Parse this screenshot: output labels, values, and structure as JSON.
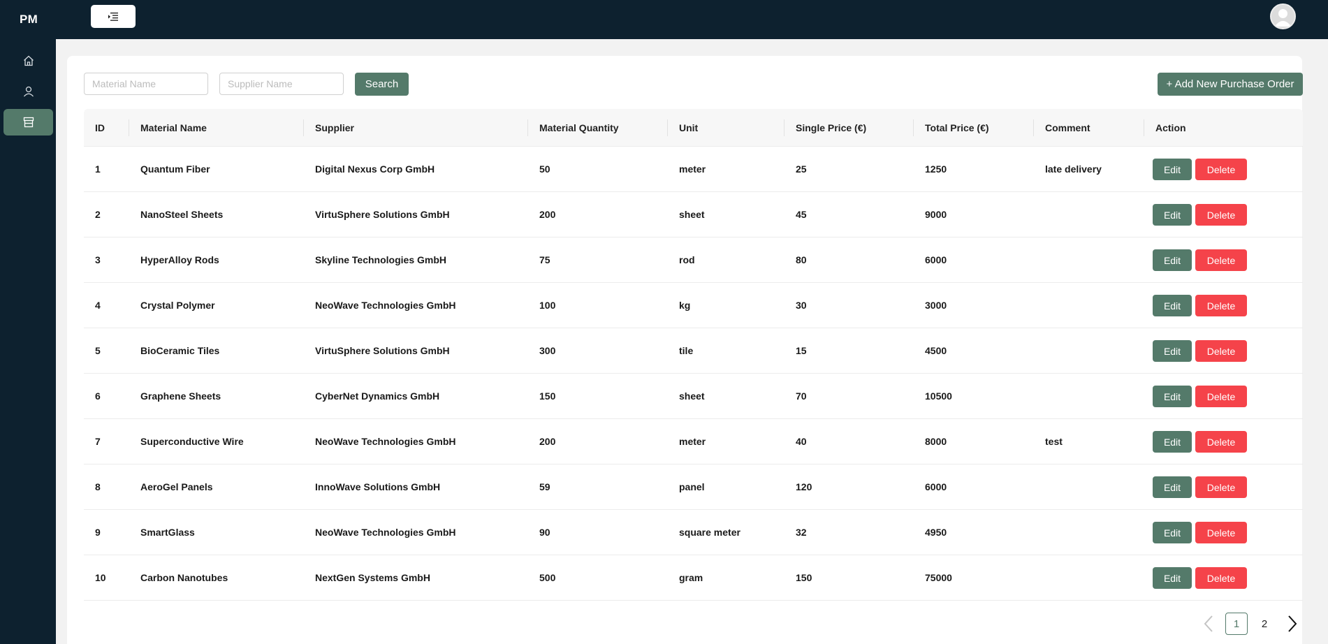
{
  "app": {
    "brand": "PM"
  },
  "filters": {
    "material_placeholder": "Material Name",
    "supplier_placeholder": "Supplier Name",
    "search_label": "Search",
    "add_label": "+ Add New Purchase Order"
  },
  "table": {
    "columns": [
      "ID",
      "Material Name",
      "Supplier",
      "Material Quantity",
      "Unit",
      "Single Price (€)",
      "Total Price (€)",
      "Comment",
      "Action"
    ],
    "rows": [
      {
        "id": "1",
        "material": "Quantum Fiber",
        "supplier": "Digital Nexus Corp GmbH",
        "quantity": "50",
        "unit": "meter",
        "single": "25",
        "total": "1250",
        "comment": "late delivery"
      },
      {
        "id": "2",
        "material": "NanoSteel Sheets",
        "supplier": "VirtuSphere Solutions GmbH",
        "quantity": "200",
        "unit": "sheet",
        "single": "45",
        "total": "9000",
        "comment": ""
      },
      {
        "id": "3",
        "material": "HyperAlloy Rods",
        "supplier": "Skyline Technologies GmbH",
        "quantity": "75",
        "unit": "rod",
        "single": "80",
        "total": "6000",
        "comment": ""
      },
      {
        "id": "4",
        "material": "Crystal Polymer",
        "supplier": "NeoWave Technologies GmbH",
        "quantity": "100",
        "unit": "kg",
        "single": "30",
        "total": "3000",
        "comment": ""
      },
      {
        "id": "5",
        "material": "BioCeramic Tiles",
        "supplier": "VirtuSphere Solutions GmbH",
        "quantity": "300",
        "unit": "tile",
        "single": "15",
        "total": "4500",
        "comment": ""
      },
      {
        "id": "6",
        "material": "Graphene Sheets",
        "supplier": "CyberNet Dynamics GmbH",
        "quantity": "150",
        "unit": "sheet",
        "single": "70",
        "total": "10500",
        "comment": ""
      },
      {
        "id": "7",
        "material": "Superconductive Wire",
        "supplier": "NeoWave Technologies GmbH",
        "quantity": "200",
        "unit": "meter",
        "single": "40",
        "total": "8000",
        "comment": "test"
      },
      {
        "id": "8",
        "material": "AeroGel Panels",
        "supplier": "InnoWave Solutions GmbH",
        "quantity": "59",
        "unit": "panel",
        "single": "120",
        "total": "6000",
        "comment": ""
      },
      {
        "id": "9",
        "material": "SmartGlass",
        "supplier": "NeoWave Technologies GmbH",
        "quantity": "90",
        "unit": "square meter",
        "single": "32",
        "total": "4950",
        "comment": ""
      },
      {
        "id": "10",
        "material": "Carbon Nanotubes",
        "supplier": "NextGen Systems GmbH",
        "quantity": "500",
        "unit": "gram",
        "single": "150",
        "total": "75000",
        "comment": ""
      }
    ],
    "edit_label": "Edit",
    "delete_label": "Delete"
  },
  "pagination": {
    "pages": [
      "1",
      "2"
    ],
    "current": "1"
  },
  "icons": {
    "menu": "menu-indent-icon",
    "avatar": "user-avatar-icon",
    "sidebar": [
      "home-icon",
      "user-icon",
      "shop-icon"
    ],
    "prev": "chevron-left-icon",
    "next": "chevron-right-icon"
  },
  "colors": {
    "nav_bg": "#0d212f",
    "accent": "#547a6a",
    "danger": "#f5434a"
  }
}
